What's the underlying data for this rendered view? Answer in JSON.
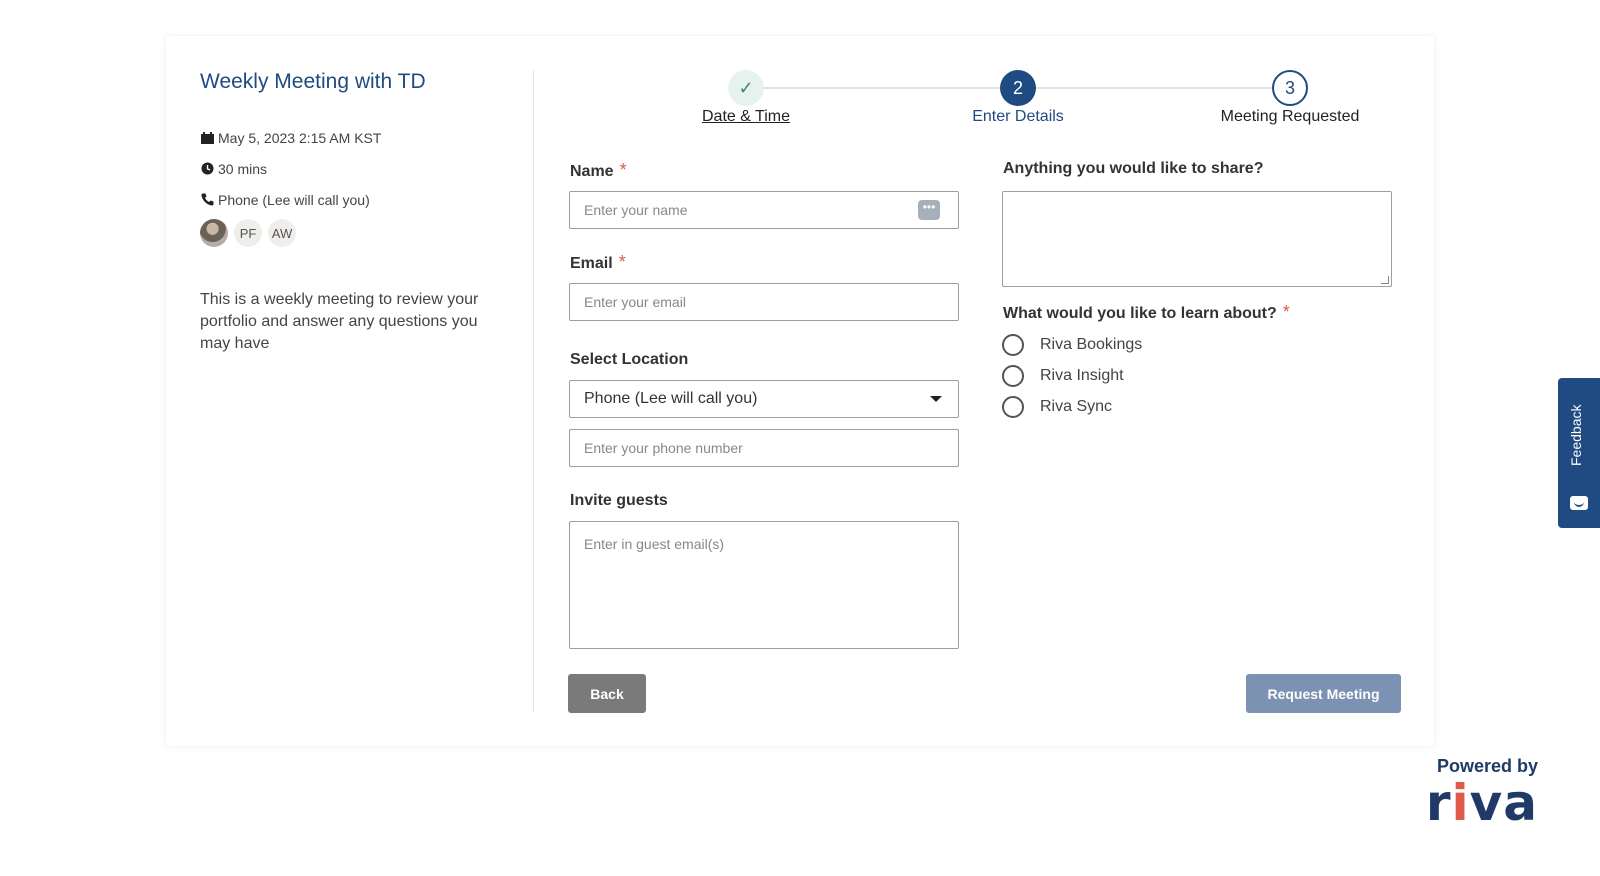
{
  "meeting": {
    "title": "Weekly Meeting with TD",
    "date": "May 5, 2023 2:15 AM KST",
    "duration": "30 mins",
    "location": "Phone (Lee will call you)",
    "attendees": [
      "PF",
      "AW"
    ],
    "description": "This is a weekly meeting to review your portfolio and answer any questions you may have"
  },
  "steps": [
    {
      "label": "Date & Time",
      "marker": "✓",
      "state": "done"
    },
    {
      "label": "Enter Details",
      "marker": "2",
      "state": "active"
    },
    {
      "label": "Meeting Requested",
      "marker": "3",
      "state": "upcoming"
    }
  ],
  "form": {
    "name_label": "Name",
    "name_placeholder": "Enter your name",
    "email_label": "Email",
    "email_placeholder": "Enter your email",
    "required_mark": "*",
    "location_label": "Select Location",
    "location_value": "Phone (Lee will call you)",
    "phone_placeholder": "Enter your phone number",
    "guests_label": "Invite guests",
    "guests_placeholder": "Enter in guest email(s)",
    "share_label": "Anything you would like to share?",
    "learn_label": "What would you like to learn about?",
    "learn_options": [
      "Riva Bookings",
      "Riva Insight",
      "Riva Sync"
    ]
  },
  "buttons": {
    "back": "Back",
    "request": "Request Meeting"
  },
  "feedback": {
    "label": "Feedback"
  },
  "branding": {
    "powered_by": "Powered by",
    "logo_left": "r",
    "logo_accent": "i",
    "logo_right": "va",
    "brand_color": "#1f3a66",
    "accent_color": "#e05a4c"
  }
}
